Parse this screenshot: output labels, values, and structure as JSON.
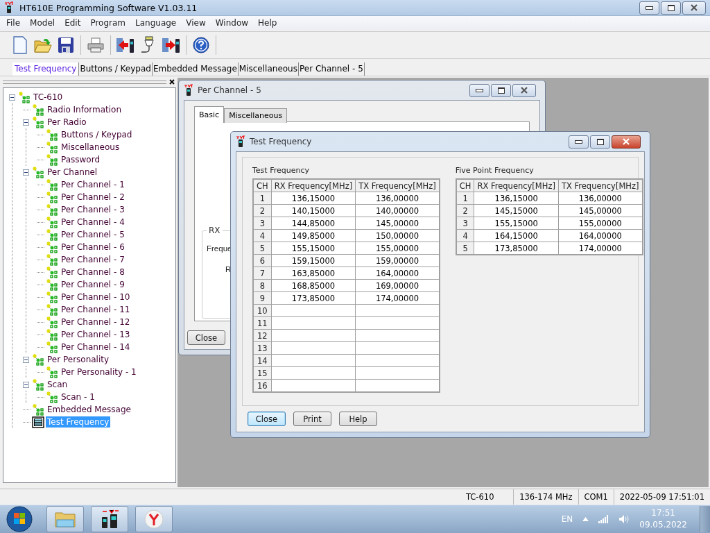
{
  "window": {
    "title": "HT610E Programming Software V1.03.11"
  },
  "menu": [
    "File",
    "Model",
    "Edit",
    "Program",
    "Language",
    "View",
    "Window",
    "Help"
  ],
  "document_tabs": [
    {
      "label": "Test Frequency",
      "selected": true
    },
    {
      "label": "Buttons / Keypad",
      "selected": false
    },
    {
      "label": "Embedded Message",
      "selected": false
    },
    {
      "label": "Miscellaneous",
      "selected": false
    },
    {
      "label": "Per Channel - 5",
      "selected": false
    }
  ],
  "tree": [
    {
      "label": "TC-610",
      "kind": "node",
      "expanded": true,
      "selected": false,
      "children": [
        {
          "label": "Radio Information",
          "kind": "node",
          "selected": false
        },
        {
          "label": "Per Radio",
          "kind": "node",
          "expanded": true,
          "selected": false,
          "children": [
            {
              "label": "Buttons / Keypad",
              "kind": "node",
              "selected": false
            },
            {
              "label": "Miscellaneous",
              "kind": "node",
              "selected": false
            },
            {
              "label": "Password",
              "kind": "node",
              "selected": false
            }
          ]
        },
        {
          "label": "Per Channel",
          "kind": "node",
          "expanded": true,
          "selected": false,
          "children": [
            {
              "label": "Per Channel - 1",
              "kind": "node",
              "selected": false
            },
            {
              "label": "Per Channel - 2",
              "kind": "node",
              "selected": false
            },
            {
              "label": "Per Channel - 3",
              "kind": "node",
              "selected": false
            },
            {
              "label": "Per Channel - 4",
              "kind": "node",
              "selected": false
            },
            {
              "label": "Per Channel - 5",
              "kind": "node",
              "selected": false
            },
            {
              "label": "Per Channel - 6",
              "kind": "node",
              "selected": false
            },
            {
              "label": "Per Channel - 7",
              "kind": "node",
              "selected": false
            },
            {
              "label": "Per Channel - 8",
              "kind": "node",
              "selected": false
            },
            {
              "label": "Per Channel - 9",
              "kind": "node",
              "selected": false
            },
            {
              "label": "Per Channel - 10",
              "kind": "node",
              "selected": false
            },
            {
              "label": "Per Channel - 11",
              "kind": "node",
              "selected": false
            },
            {
              "label": "Per Channel - 12",
              "kind": "node",
              "selected": false
            },
            {
              "label": "Per Channel - 13",
              "kind": "node",
              "selected": false
            },
            {
              "label": "Per Channel - 14",
              "kind": "node",
              "selected": false
            }
          ]
        },
        {
          "label": "Per Personality",
          "kind": "node",
          "expanded": true,
          "selected": false,
          "children": [
            {
              "label": "Per Personality - 1",
              "kind": "node",
              "selected": false
            }
          ]
        },
        {
          "label": "Scan",
          "kind": "node",
          "expanded": true,
          "selected": false,
          "children": [
            {
              "label": "Scan - 1",
              "kind": "node",
              "selected": false
            }
          ]
        },
        {
          "label": "Embedded Message",
          "kind": "node",
          "selected": false
        },
        {
          "label": "Test Frequency",
          "kind": "table",
          "selected": true
        }
      ]
    }
  ],
  "per_channel_window": {
    "title": "Per Channel - 5",
    "tabs": [
      {
        "label": "Basic",
        "selected": true
      },
      {
        "label": "Miscellaneous",
        "selected": false
      }
    ],
    "group_label": "RX",
    "field_labels": [
      "Freque",
      "R"
    ],
    "close_button": "Close"
  },
  "test_frequency_window": {
    "title": "Test Frequency",
    "tables": [
      {
        "heading": "Test Frequency",
        "columns": [
          "CH",
          "RX Frequency[MHz]",
          "TX Frequency[MHz]"
        ],
        "rows": [
          {
            "ch": "1",
            "rx": "136,15000",
            "tx": "136,00000"
          },
          {
            "ch": "2",
            "rx": "140,15000",
            "tx": "140,00000"
          },
          {
            "ch": "3",
            "rx": "144,85000",
            "tx": "145,00000"
          },
          {
            "ch": "4",
            "rx": "149,85000",
            "tx": "150,00000"
          },
          {
            "ch": "5",
            "rx": "155,15000",
            "tx": "155,00000"
          },
          {
            "ch": "6",
            "rx": "159,15000",
            "tx": "159,00000"
          },
          {
            "ch": "7",
            "rx": "163,85000",
            "tx": "164,00000"
          },
          {
            "ch": "8",
            "rx": "168,85000",
            "tx": "169,00000"
          },
          {
            "ch": "9",
            "rx": "173,85000",
            "tx": "174,00000"
          },
          {
            "ch": "10"
          },
          {
            "ch": "11"
          },
          {
            "ch": "12"
          },
          {
            "ch": "13"
          },
          {
            "ch": "14"
          },
          {
            "ch": "15"
          },
          {
            "ch": "16"
          }
        ]
      },
      {
        "heading": "Five Point Frequency",
        "columns": [
          "CH",
          "RX Frequency[MHz]",
          "TX Frequency[MHz]"
        ],
        "rows": [
          {
            "ch": "1",
            "rx": "136,15000",
            "tx": "136,00000"
          },
          {
            "ch": "2",
            "rx": "145,15000",
            "tx": "145,00000"
          },
          {
            "ch": "3",
            "rx": "155,15000",
            "tx": "155,00000"
          },
          {
            "ch": "4",
            "rx": "164,15000",
            "tx": "164,00000"
          },
          {
            "ch": "5",
            "rx": "173,85000",
            "tx": "174,00000"
          }
        ]
      }
    ],
    "buttons": [
      {
        "label": "Close",
        "focused": true
      },
      {
        "label": "Print",
        "focused": false
      },
      {
        "label": "Help",
        "focused": false
      }
    ]
  },
  "status_bar": [
    "TC-610",
    "136-174 MHz",
    "COM1",
    "2022-05-09 17:51:01"
  ],
  "taskbar": {
    "language": "EN",
    "time": "17:51",
    "date": "09.05.2022"
  }
}
